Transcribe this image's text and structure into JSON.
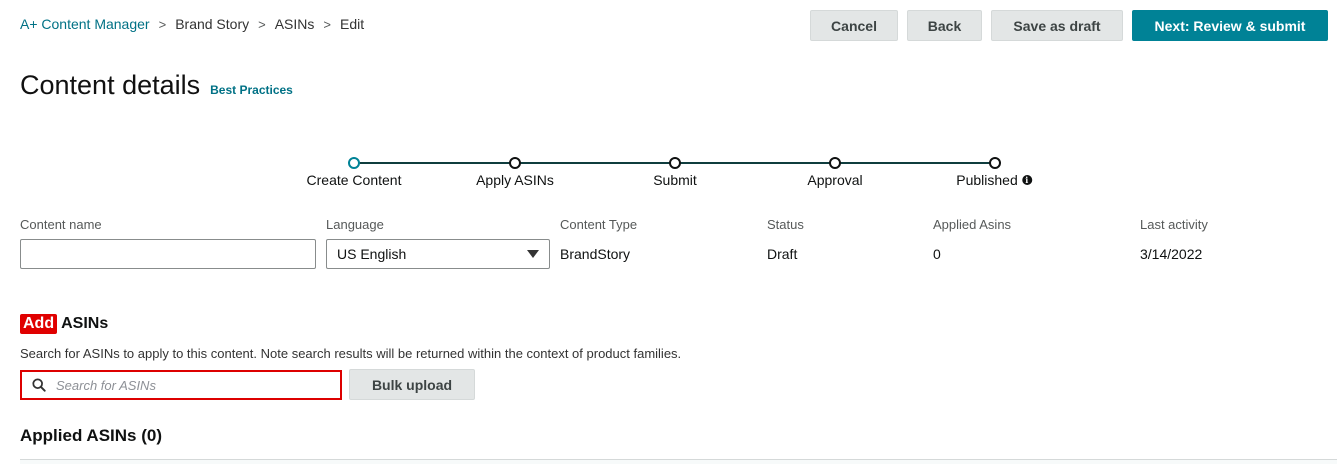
{
  "breadcrumb": [
    {
      "label": "A+ Content Manager",
      "link": true
    },
    {
      "label": "Brand Story",
      "link": false
    },
    {
      "label": "ASINs",
      "link": false
    },
    {
      "label": "Edit",
      "link": false
    }
  ],
  "actions": {
    "cancel": "Cancel",
    "back": "Back",
    "save_draft": "Save as draft",
    "next": "Next: Review & submit"
  },
  "header": {
    "title": "Content details",
    "best_practices": "Best Practices"
  },
  "stepper": {
    "steps": [
      "Create Content",
      "Apply ASINs",
      "Submit",
      "Approval",
      "Published"
    ],
    "active_index": 0
  },
  "details": {
    "content_name_label": "Content name",
    "content_name_value": "",
    "language_label": "Language",
    "language_value": "US English",
    "content_type_label": "Content Type",
    "content_type_value": "BrandStory",
    "status_label": "Status",
    "status_value": "Draft",
    "applied_asins_label": "Applied Asins",
    "applied_asins_value": "0",
    "last_activity_label": "Last activity",
    "last_activity_value": "3/14/2022"
  },
  "add_asins": {
    "highlight": "Add",
    "heading": "ASINs",
    "description": "Search for ASINs to apply to this content. Note search results will be returned within the context of product families.",
    "search_placeholder": "Search for ASINs",
    "bulk_upload": "Bulk upload"
  },
  "applied": {
    "heading": "Applied ASINs (0)"
  },
  "colors": {
    "link": "#007185",
    "primary": "#008296",
    "highlight": "#e00000",
    "search_border": "#dd0000"
  }
}
